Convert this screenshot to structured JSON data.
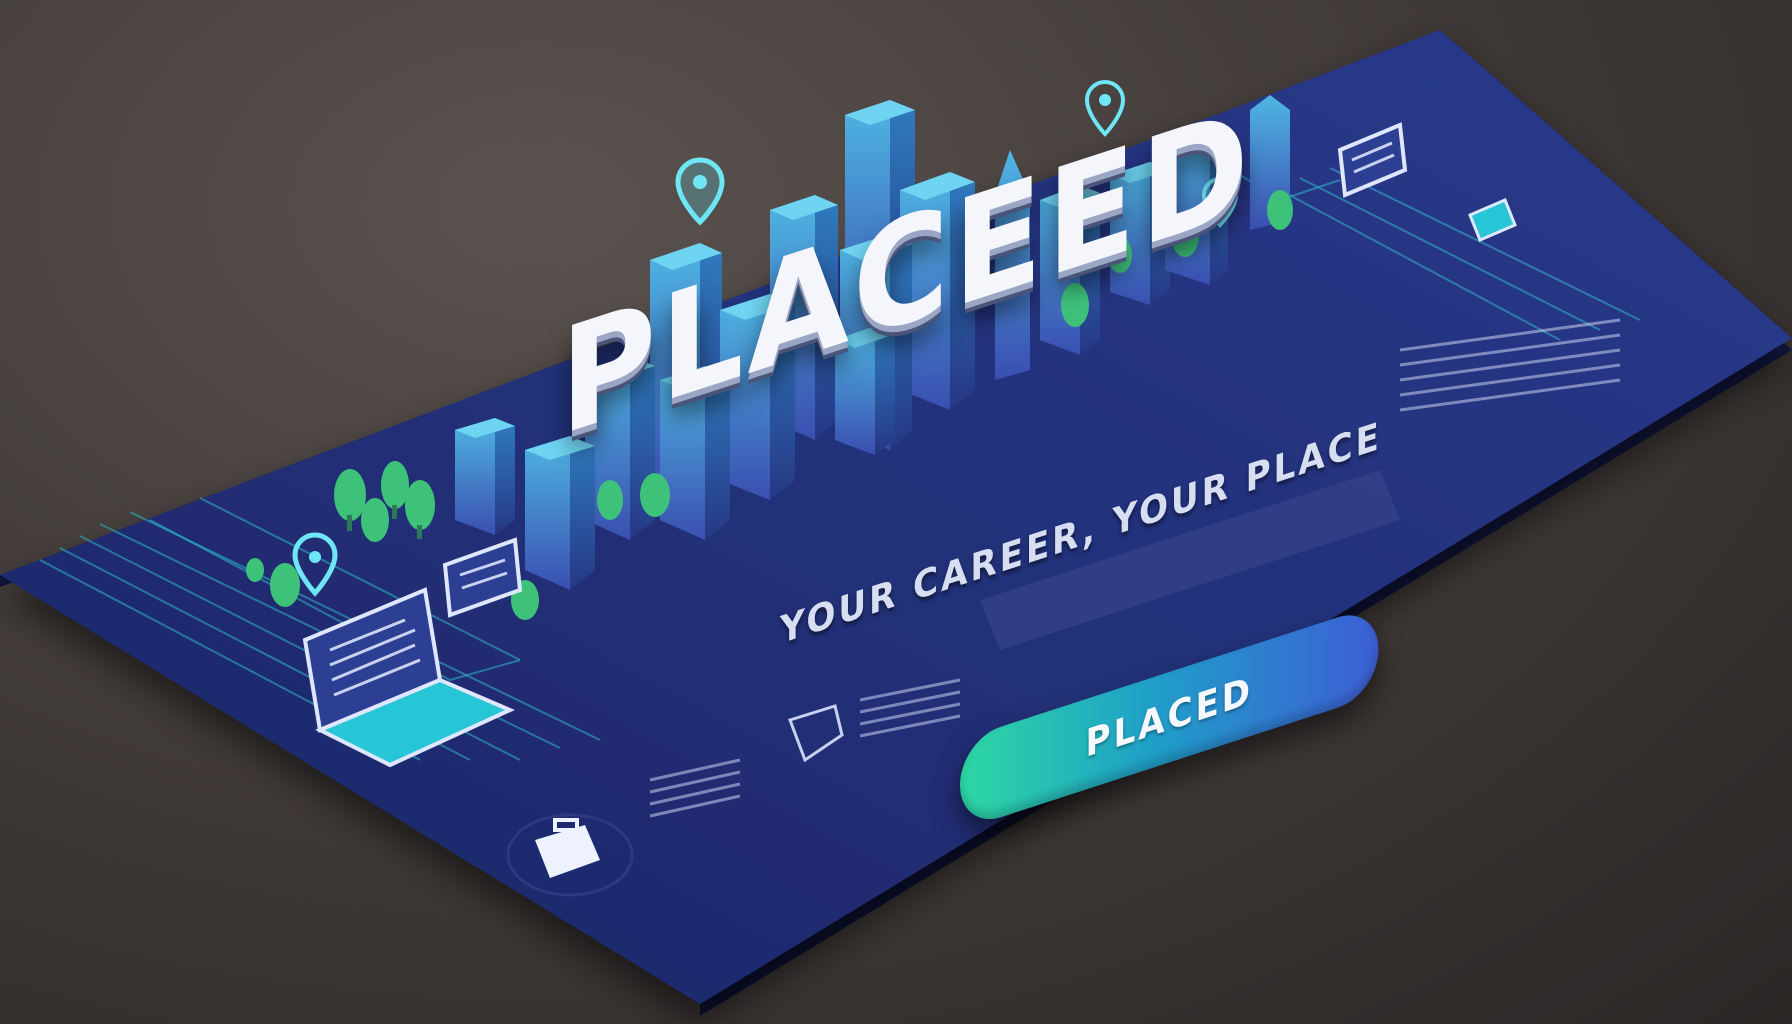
{
  "brand": {
    "wordmark": "PLACEED",
    "tagline": "YOUR CAREER, YOUR PLACE"
  },
  "badge": {
    "label": "PLACED"
  },
  "colors": {
    "mat_dark": "#1c2466",
    "mat_mid": "#2a3a8c",
    "mat_accent": "#1e5f8a",
    "building_light": "#4fb6e3",
    "building_dark": "#3a4fb0",
    "tree_green": "#3ec27a",
    "pill_start": "#2ed8a4",
    "pill_end": "#3d5ed6",
    "background": "#3e3836"
  },
  "icons": [
    "map-pin-icon",
    "laptop-icon",
    "monitor-icon",
    "briefcase-icon",
    "tree-icon"
  ]
}
